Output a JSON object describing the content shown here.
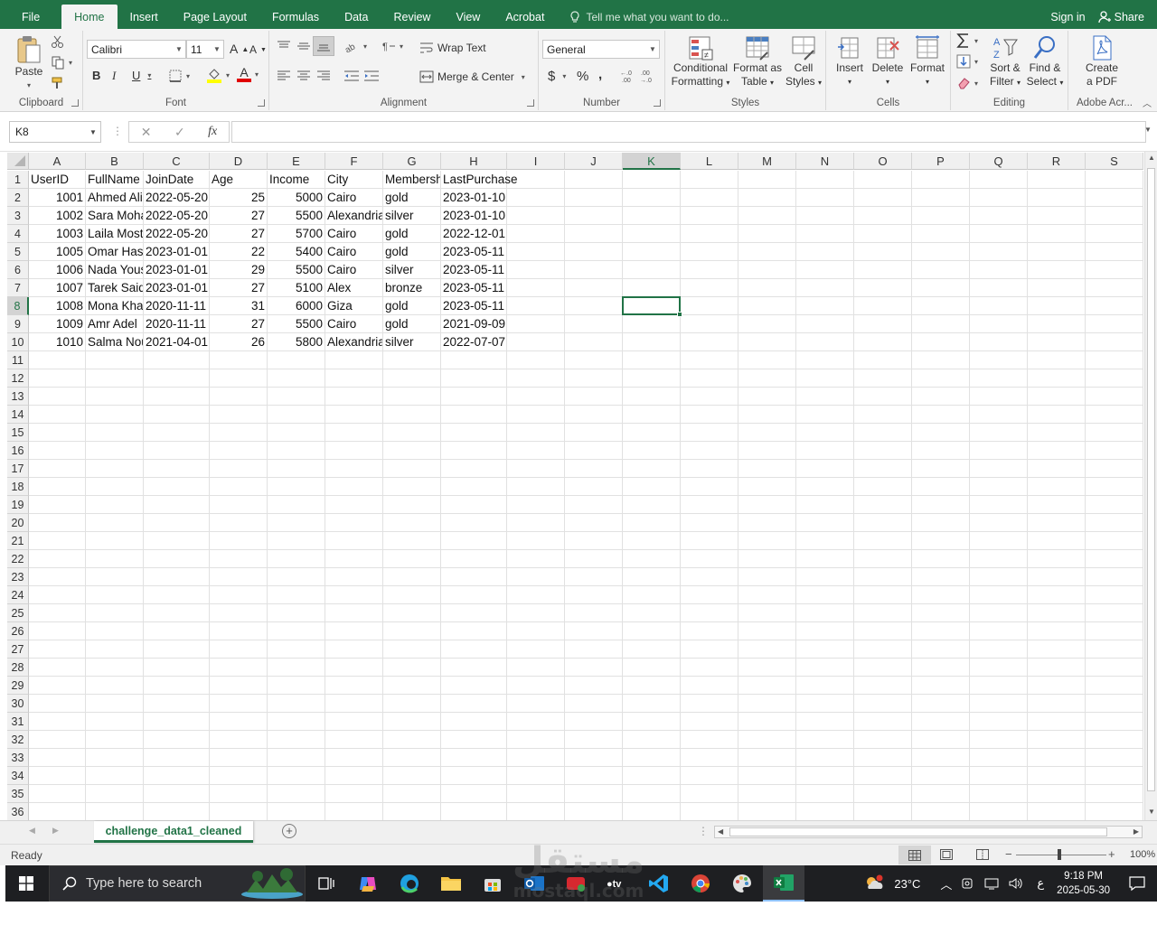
{
  "ribbon_tabs": [
    "File",
    "Home",
    "Insert",
    "Page Layout",
    "Formulas",
    "Data",
    "Review",
    "View",
    "Acrobat"
  ],
  "active_tab": "Home",
  "tell_me": "Tell me what you want to do...",
  "sign_in": "Sign in",
  "share": "Share",
  "clipboard": {
    "label": "Clipboard",
    "paste": "Paste"
  },
  "font": {
    "label": "Font",
    "name": "Calibri",
    "size": "11",
    "bold": "B",
    "italic": "I",
    "underline": "U",
    "grow": "A",
    "shrink": "A",
    "color_letter": "A"
  },
  "alignment": {
    "label": "Alignment",
    "wrap": "Wrap Text",
    "merge": "Merge & Center"
  },
  "number": {
    "label": "Number",
    "format": "General",
    "currency": "$",
    "percent": "%",
    "comma": ","
  },
  "styles": {
    "label": "Styles",
    "conditional": [
      "Conditional",
      "Formatting"
    ],
    "format_table": [
      "Format as",
      "Table"
    ],
    "cell_styles": [
      "Cell",
      "Styles"
    ]
  },
  "cells": {
    "label": "Cells",
    "insert": "Insert",
    "delete": "Delete",
    "format": "Format"
  },
  "editing": {
    "label": "Editing",
    "sort": [
      "Sort &",
      "Filter"
    ],
    "find": [
      "Find &",
      "Select"
    ]
  },
  "adobe": {
    "label": "Adobe Acr...",
    "create": [
      "Create",
      "a PDF"
    ]
  },
  "name_box": "K8",
  "formula": "",
  "fx": "fx",
  "columns": [
    "A",
    "B",
    "C",
    "D",
    "E",
    "F",
    "G",
    "H",
    "I",
    "J",
    "K",
    "L",
    "M",
    "N",
    "O",
    "P",
    "Q",
    "R",
    "S"
  ],
  "selected_column": "K",
  "selected_row": 8,
  "row_numbers": [
    1,
    2,
    3,
    4,
    5,
    6,
    7,
    8,
    9,
    10,
    11,
    12,
    13,
    14,
    15,
    16,
    17,
    18,
    19,
    20,
    21,
    22,
    23,
    24,
    25,
    26,
    27,
    28,
    29,
    30,
    31,
    32,
    33,
    34,
    35,
    36
  ],
  "headers": [
    "UserID",
    "FullName",
    "JoinDate",
    "Age",
    "Income",
    "City",
    "Membership",
    "LastPurchase"
  ],
  "rows": [
    [
      "1001",
      "Ahmed Ali",
      "2022-05-20",
      "25",
      "5000",
      "Cairo",
      "gold",
      "2023-01-10"
    ],
    [
      "1002",
      "Sara Mohamed",
      "2022-05-20",
      "27",
      "5500",
      "Alexandria",
      "silver",
      "2023-01-10"
    ],
    [
      "1003",
      "Laila Mostafa",
      "2022-05-20",
      "27",
      "5700",
      "Cairo",
      "gold",
      "2022-12-01"
    ],
    [
      "1005",
      "Omar Hassan",
      "2023-01-01",
      "22",
      "5400",
      "Cairo",
      "gold",
      "2023-05-11"
    ],
    [
      "1006",
      "Nada Youssef",
      "2023-01-01",
      "29",
      "5500",
      "Cairo",
      "silver",
      "2023-05-11"
    ],
    [
      "1007",
      "Tarek Said",
      "2023-01-01",
      "27",
      "5100",
      "Alex",
      "bronze",
      "2023-05-11"
    ],
    [
      "1008",
      "Mona Khaled",
      "2020-11-11",
      "31",
      "6000",
      "Giza",
      "gold",
      "2023-05-11"
    ],
    [
      "1009",
      "Amr Adel",
      "2020-11-11",
      "27",
      "5500",
      "Cairo",
      "gold",
      "2021-09-09"
    ],
    [
      "1010",
      "Salma Nour",
      "2021-04-01",
      "26",
      "5800",
      "Alexandria",
      "silver",
      "2022-07-07"
    ]
  ],
  "sheet_tab": "challenge_data1_cleaned",
  "status": "Ready",
  "zoom": "100%",
  "taskbar": {
    "search": "Type here to search",
    "temp": "23°C",
    "time": "9:18 PM",
    "date": "2025-05-30",
    "lang": "ع"
  },
  "watermark": {
    "ar": "مستقل",
    "en": "mostaql.com"
  }
}
